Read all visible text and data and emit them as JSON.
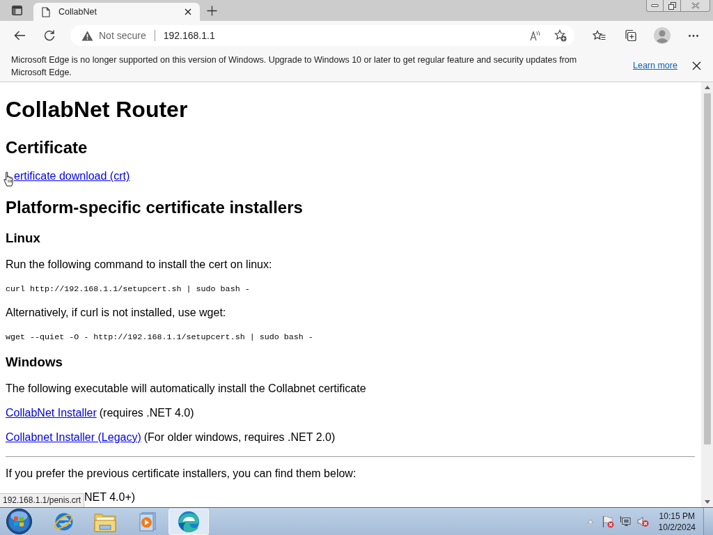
{
  "tabs": [
    {
      "title": "CollabNet",
      "selected": true
    }
  ],
  "address_bar": {
    "security_label": "Not secure",
    "url": "192.168.1.1"
  },
  "banner": {
    "message": "Microsoft Edge is no longer supported on this version of Windows. Upgrade to Windows 10 or later to get regular feature and security updates from Microsoft Edge.",
    "link": "Learn more"
  },
  "page": {
    "blocks": [
      {
        "kind": "h1",
        "text": "CollabNet Router"
      },
      {
        "kind": "h2",
        "text": "Certificate"
      },
      {
        "kind": "covered_link",
        "link": "ertificate download (crt)"
      },
      {
        "kind": "h2",
        "text": "Platform-specific certificate installers"
      },
      {
        "kind": "h3",
        "text": "Linux"
      },
      {
        "kind": "p",
        "text": "Run the following command to install the cert on linux:"
      },
      {
        "kind": "code",
        "text": "curl http://192.168.1.1/setupcert.sh | sudo bash -"
      },
      {
        "kind": "p",
        "text": "Alternatively, if curl is not installed, use wget:"
      },
      {
        "kind": "code",
        "text": "wget --quiet -O - http://192.168.1.1/setupcert.sh | sudo bash -"
      },
      {
        "kind": "h3",
        "text": "Windows"
      },
      {
        "kind": "p",
        "text": "The following executable will automatically install the Collabnet certificate"
      },
      {
        "kind": "link",
        "link": "CollabNet Installer",
        "note": "(requires .NET 4.0)"
      },
      {
        "kind": "link",
        "link": "Collabnet Installer (Legacy)",
        "note": "(For older windows, requires .NET 2.0)"
      },
      {
        "kind": "rule"
      },
      {
        "kind": "p",
        "text": "If you prefer the previous certificate installers, you can find them below:"
      },
      {
        "kind": "covered",
        "text": "NET 4.0+)"
      }
    ]
  },
  "status_url": "192.168.1.1/penis.crt",
  "taskbar": {
    "apps": [
      {
        "kind": "ie",
        "selected": false
      },
      {
        "kind": "folder",
        "selected": false
      },
      {
        "kind": "media",
        "selected": false
      },
      {
        "kind": "edge",
        "selected": true
      }
    ],
    "clock": {
      "time": "10:15 PM",
      "date": "10/2/2024"
    }
  }
}
